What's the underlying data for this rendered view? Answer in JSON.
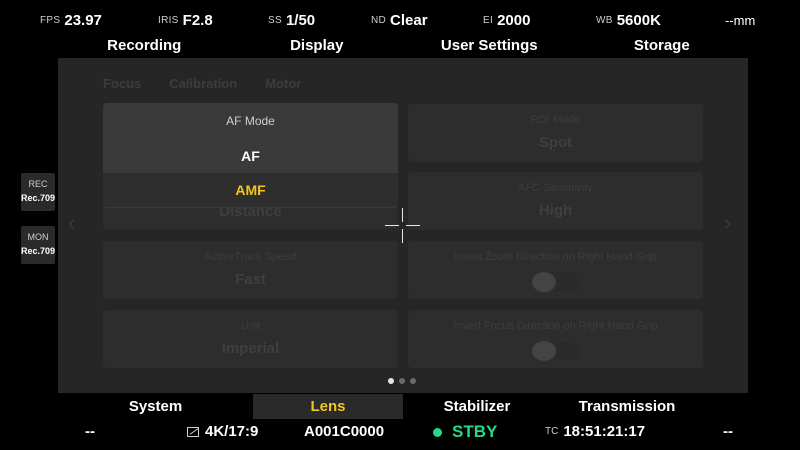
{
  "status_bar": {
    "fps_label": "FPS",
    "fps_value": "23.97",
    "iris_label": "IRIS",
    "iris_value": "F2.8",
    "ss_label": "SS",
    "ss_value": "1/50",
    "nd_label": "ND",
    "nd_value": "Clear",
    "ei_label": "EI",
    "ei_value": "2000",
    "wb_label": "WB",
    "wb_value": "5600K",
    "focal": "--mm"
  },
  "top_tabs": [
    "Recording",
    "Display",
    "User Settings",
    "Storage"
  ],
  "sub_tabs": [
    "Focus",
    "Calibration",
    "Motor"
  ],
  "settings": {
    "af_mode_title": "AF Mode",
    "af_mode_value": "AMF",
    "roi_title": "ROI Mode",
    "roi_value": "Spot",
    "focus_assist_value": "Distance",
    "afc_title": "AFC Sensitivity",
    "afc_value": "High",
    "activetrack_title": "ActiveTrack Speed",
    "activetrack_value": "Fast",
    "zoom_dir_title": "Invert Zoom Direction on Right Hand Grip",
    "unit_title": "Unit",
    "unit_value": "Imperial",
    "focus_dir_title": "Invert Focus Direction on Right Hand Grip"
  },
  "dropdown": {
    "title": "AF Mode",
    "options": [
      "AF",
      "AMF"
    ],
    "selected": "AMF"
  },
  "side_panels": {
    "rec_label": "REC",
    "rec_value": "Rec.709",
    "mon_label": "MON",
    "mon_value": "Rec.709"
  },
  "bottom_tabs": [
    "System",
    "Lens",
    "Stabilizer",
    "Transmission"
  ],
  "active_bottom_tab": "Lens",
  "bottom_status": {
    "left": "--",
    "resolution": "4K/17:9",
    "clip": "A001C0000",
    "state": "STBY",
    "tc_label": "TC",
    "timecode": "18:51:21:17",
    "right": "--"
  },
  "page_indicator": {
    "pages": 3,
    "current": 1
  },
  "colors": {
    "accent": "#f2c61c",
    "standby": "#27d884"
  }
}
